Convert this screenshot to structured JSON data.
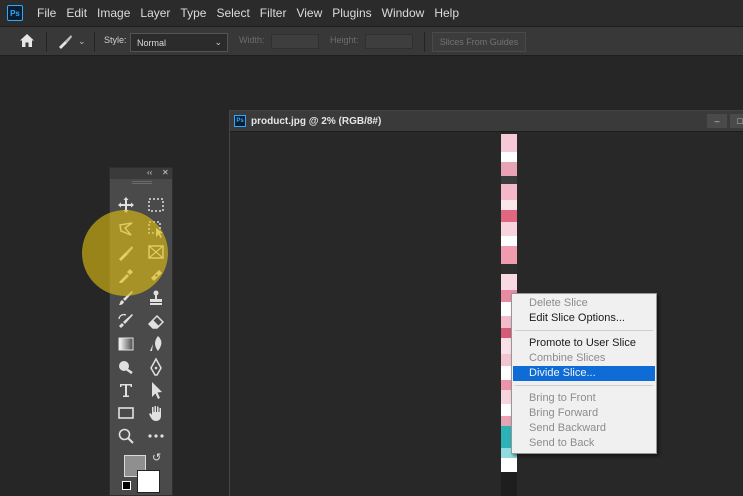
{
  "menubar": {
    "logo": "Ps",
    "items": [
      "File",
      "Edit",
      "Image",
      "Layer",
      "Type",
      "Select",
      "Filter",
      "View",
      "Plugins",
      "Window",
      "Help"
    ]
  },
  "options": {
    "style_label": "Style:",
    "style_value": "Normal",
    "width_label": "Width:",
    "height_label": "Height:",
    "slices_button": "Slices From Guides"
  },
  "document": {
    "logo": "Ps",
    "title": "product.jpg @ 2% (RGB/8#)",
    "minimize": "–",
    "maximize": "□"
  },
  "tools_panel": {
    "collapse": "‹‹",
    "close": "✕"
  },
  "context_menu": {
    "items": [
      {
        "label": "Delete Slice",
        "state": "disabled"
      },
      {
        "label": "Edit Slice Options...",
        "state": "enabled"
      },
      {
        "label": "Promote to User Slice",
        "state": "enabled"
      },
      {
        "label": "Combine Slices",
        "state": "disabled"
      },
      {
        "label": "Divide Slice...",
        "state": "selected"
      },
      {
        "label": "Bring to Front",
        "state": "disabled"
      },
      {
        "label": "Bring Forward",
        "state": "disabled"
      },
      {
        "label": "Send Backward",
        "state": "disabled"
      },
      {
        "label": "Send to Back",
        "state": "disabled"
      }
    ]
  },
  "colors": {
    "highlight": "#e0be14",
    "selection": "#0f6cd6",
    "foreground_swatch": "#8f8f8f",
    "background_swatch": "#ffffff"
  }
}
